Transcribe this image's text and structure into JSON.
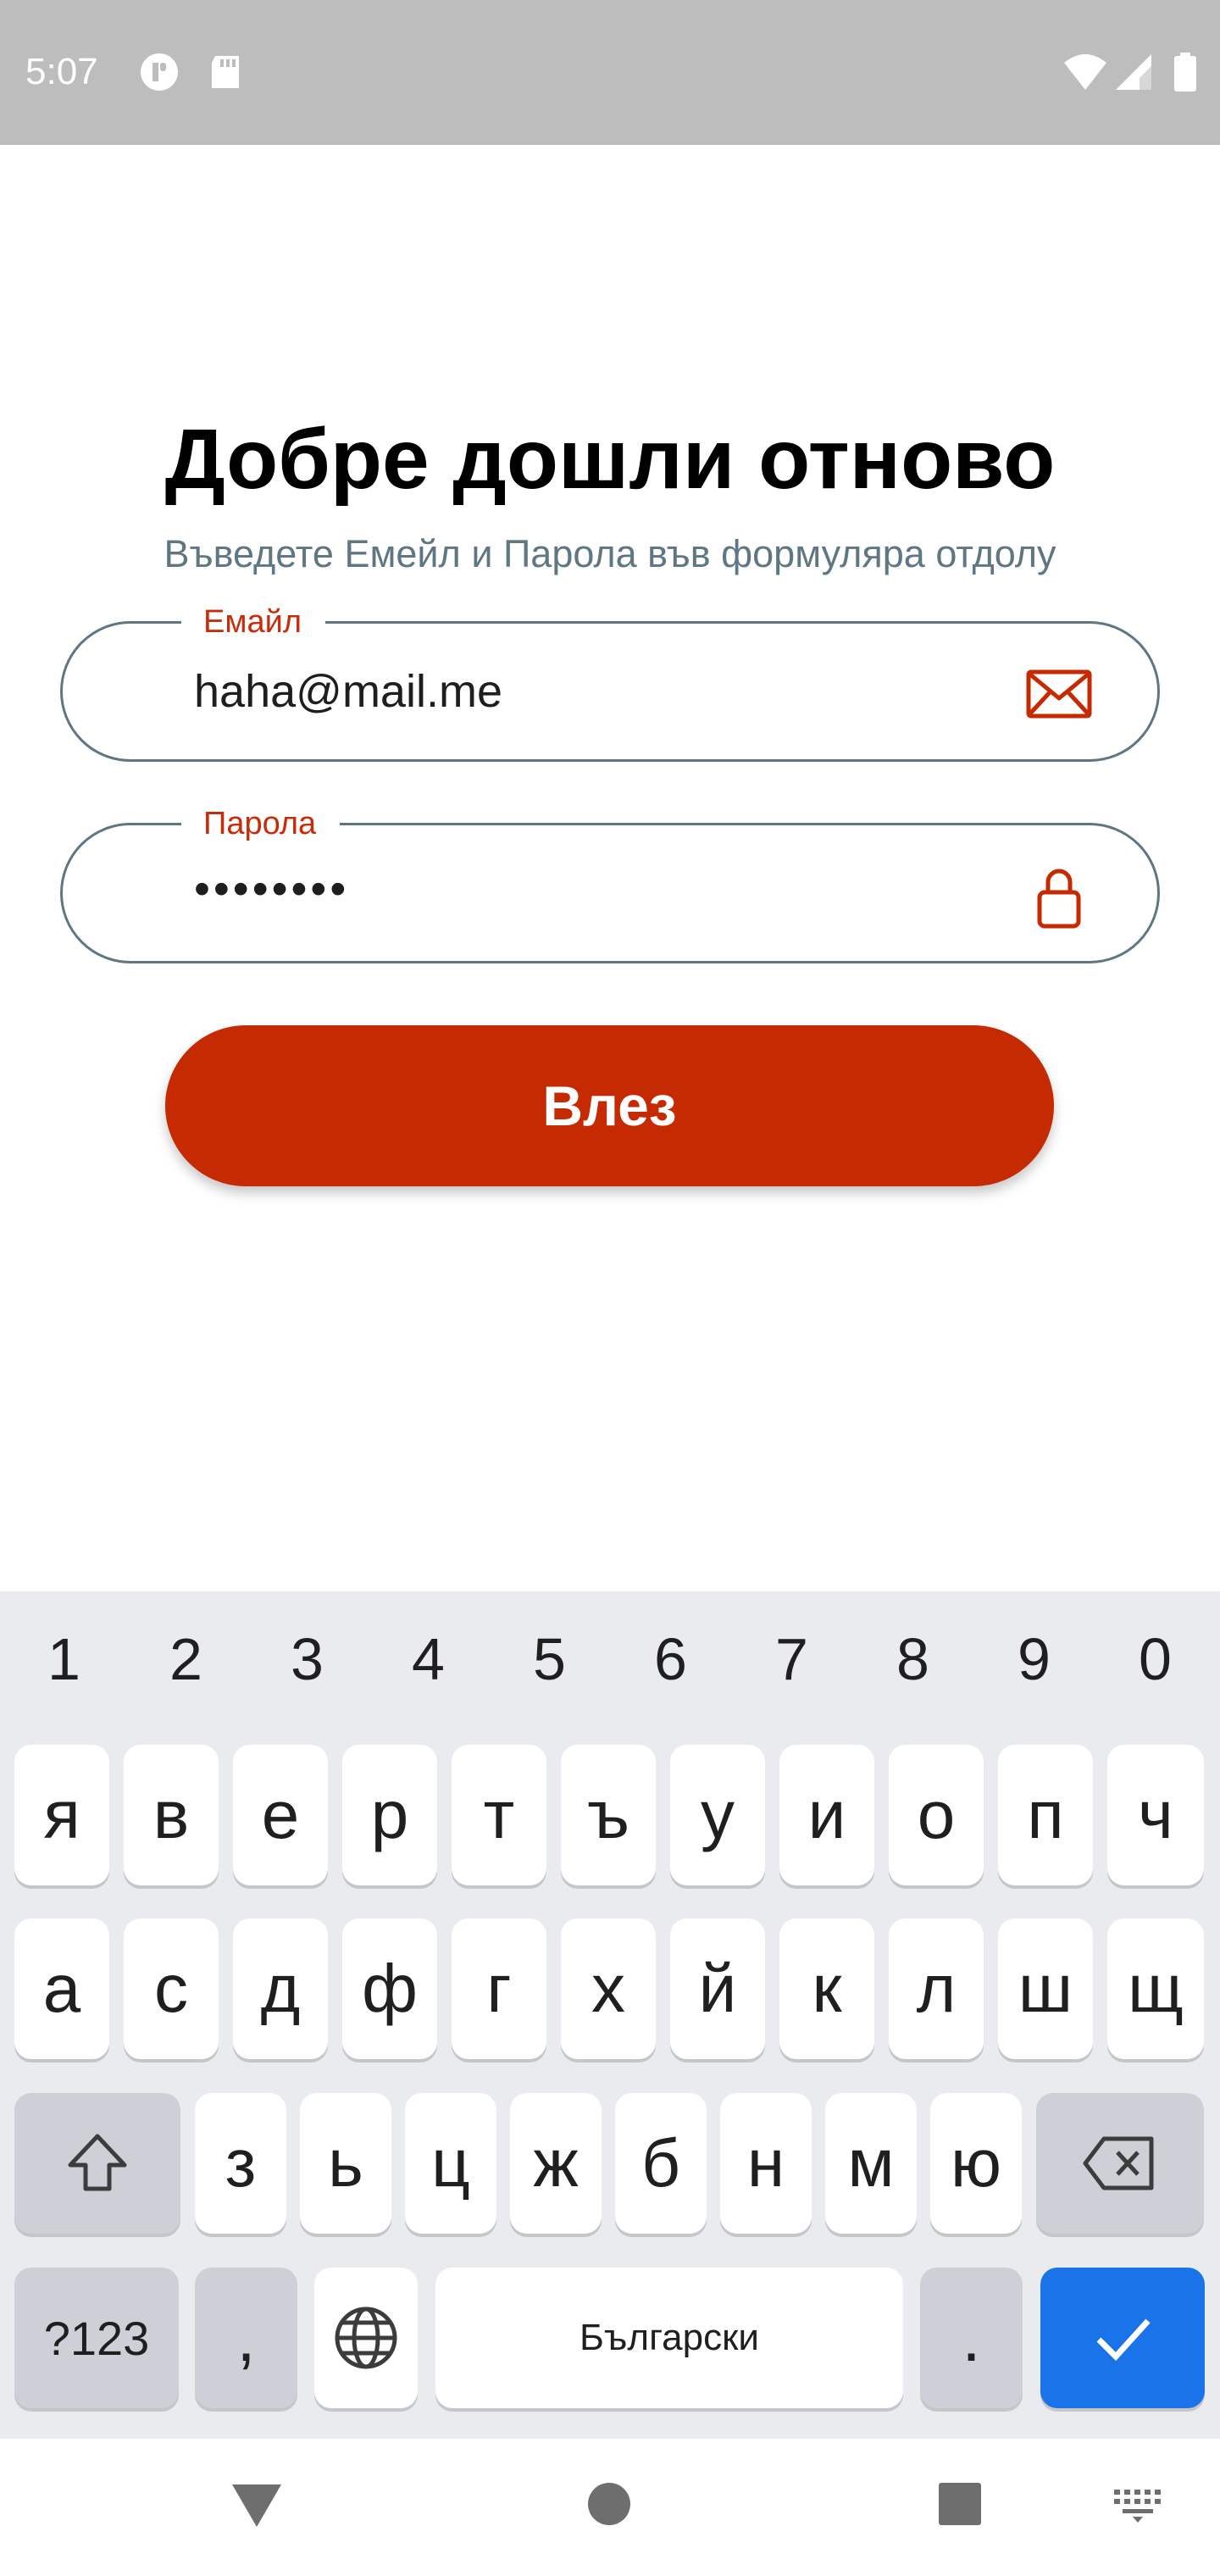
{
  "status_bar": {
    "time": "5:07",
    "icons": [
      "notification-icon",
      "sd-card-icon",
      "wifi-icon",
      "signal-icon",
      "battery-icon"
    ]
  },
  "login": {
    "title": "Добре дошли отново",
    "subtitle": "Въведете Емейл и Парола във формуляра отдолу",
    "email": {
      "label": "Емайл",
      "value": "haha@mail.me",
      "icon": "mail-icon"
    },
    "password": {
      "label": "Парола",
      "value": "••••••••",
      "icon": "lock-icon"
    },
    "submit_label": "Влез"
  },
  "keyboard": {
    "numbers": [
      "1",
      "2",
      "3",
      "4",
      "5",
      "6",
      "7",
      "8",
      "9",
      "0"
    ],
    "row1": [
      "я",
      "в",
      "е",
      "р",
      "т",
      "ъ",
      "у",
      "и",
      "о",
      "п",
      "ч"
    ],
    "row2": [
      "а",
      "с",
      "д",
      "ф",
      "г",
      "х",
      "й",
      "к",
      "л",
      "ш",
      "щ"
    ],
    "row3": [
      "з",
      "ь",
      "ц",
      "ж",
      "б",
      "н",
      "м",
      "ю"
    ],
    "symbols_label": "?123",
    "comma": ",",
    "space_label": "Български",
    "period": "."
  },
  "colors": {
    "accent": "#c52a02",
    "field_border": "#5e7682",
    "subtitle": "#5f7783",
    "enter_key": "#1a73e8"
  }
}
